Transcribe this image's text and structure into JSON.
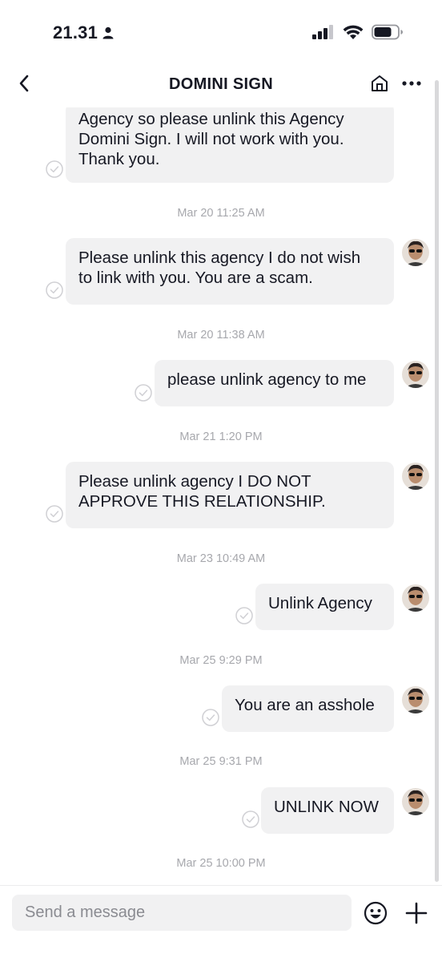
{
  "status_bar": {
    "time": "21.31",
    "person_icon": "person-icon",
    "signal_icon": "cellular-signal-icon",
    "wifi_icon": "wifi-icon",
    "battery_icon": "battery-icon"
  },
  "header": {
    "title": "DOMINI SIGN",
    "back_icon": "chevron-left-icon",
    "house_icon": "house-icon",
    "more_icon": "more-dots-icon"
  },
  "messages": [
    {
      "lines": [
        "Agency so please unlink this Agency",
        "Domini Sign. I will not work with you.",
        "Thank you."
      ],
      "avatar": false
    },
    {
      "timestamp": "Mar 20 11:25 AM",
      "lines": [
        "Please unlink this agency I do not wish",
        "to link with you. You are a scam."
      ],
      "avatar": true
    },
    {
      "timestamp": "Mar 20 11:38 AM",
      "lines": [
        "please unlink agency to me"
      ],
      "avatar": true
    },
    {
      "timestamp": "Mar 21 1:20 PM",
      "lines": [
        "Please unlink agency I DO NOT",
        "APPROVE THIS RELATIONSHIP."
      ],
      "avatar": true
    },
    {
      "timestamp": "Mar 23 10:49 AM",
      "lines": [
        "Unlink Agency"
      ],
      "avatar": true
    },
    {
      "timestamp": "Mar 25 9:29 PM",
      "lines": [
        "You are an asshole"
      ],
      "avatar": true
    },
    {
      "timestamp": "Mar 25 9:31 PM",
      "lines": [
        "UNLINK NOW"
      ],
      "avatar": true
    }
  ],
  "last_timestamp": "Mar 25 10:00 PM",
  "composer": {
    "placeholder": "Send a message",
    "emoji_icon": "emoji-icon",
    "plus_icon": "plus-icon"
  },
  "colors": {
    "bubble": "#f1f1f2",
    "text": "#161823",
    "timestamp": "#a7a8ad",
    "check": "#d0d0d4"
  }
}
